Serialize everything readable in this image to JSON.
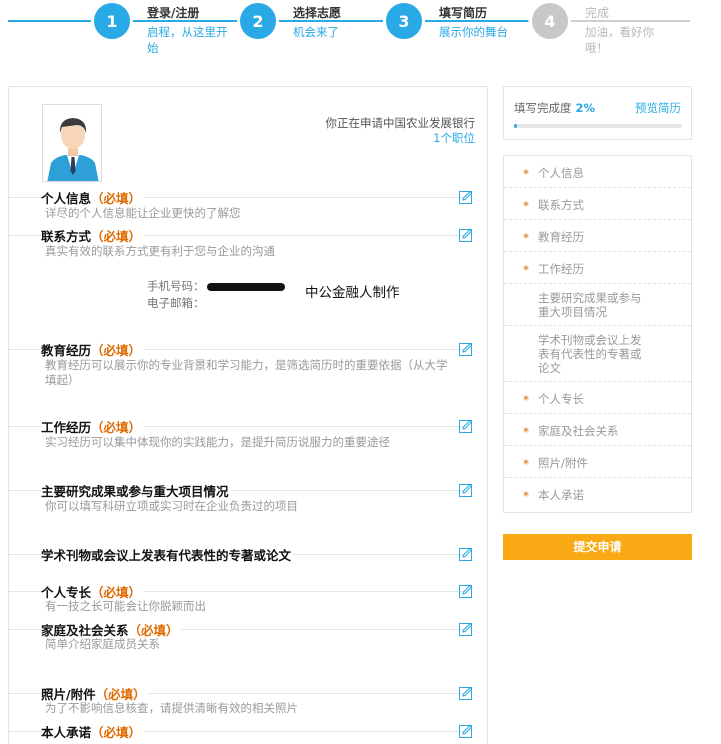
{
  "steps": [
    {
      "num": "1",
      "title": "登录/注册",
      "sub": "启程，从这里开始"
    },
    {
      "num": "2",
      "title": "选择志愿",
      "sub": "机会来了"
    },
    {
      "num": "3",
      "title": "填写简历",
      "sub": "展示你的舞台"
    },
    {
      "num": "4",
      "title": "完成",
      "sub": "加油，看好你哦！"
    }
  ],
  "apply": {
    "org_text": "你正在申请中国农业发展银行",
    "count_text": "1个职位"
  },
  "required_mark": "（必填）",
  "sections": {
    "personal": {
      "title": "个人信息",
      "desc": "详尽的个人信息能让企业更快的了解您"
    },
    "contact": {
      "title": "联系方式",
      "desc": "真实有效的联系方式更有利于您与企业的沟通"
    },
    "education": {
      "title": "教育经历",
      "desc": "教育经历可以展示你的专业背景和学习能力，是筛选简历时的重要依据（从大学填起）"
    },
    "work": {
      "title": "工作经历",
      "desc": "实习经历可以集中体现你的实践能力，是提升简历说服力的重要途径"
    },
    "research": {
      "title": "主要研究成果或参与重大项目情况",
      "desc": "你可以填写科研立项或实习时在企业负责过的项目"
    },
    "papers": {
      "title": "学术刊物或会议上发表有代表性的专著或论文"
    },
    "skills": {
      "title": "个人专长",
      "desc": "有一技之长可能会让你脱颖而出"
    },
    "family": {
      "title": "家庭及社会关系",
      "desc": "简单介绍家庭成员关系"
    },
    "photos": {
      "title": "照片/附件",
      "desc": "为了不影响信息核查，请提供清晰有效的相关照片"
    },
    "pledge": {
      "title": "本人承诺"
    }
  },
  "contact_info": {
    "phone_label": "手机号码：",
    "email_label": "电子邮箱："
  },
  "watermark": "中公金融人制作",
  "progress": {
    "label": "填写完成度",
    "value_text": "2%",
    "fraction": 0.02,
    "preview": "预览简历"
  },
  "nav": [
    {
      "label": "个人信息",
      "required": true
    },
    {
      "label": "联系方式",
      "required": true
    },
    {
      "label": "教育经历",
      "required": true
    },
    {
      "label": "工作经历",
      "required": true
    },
    {
      "label": "主要研究成果或参与重大项目情况",
      "required": false
    },
    {
      "label": "学术刊物或会议上发表有代表性的专著或论文",
      "required": false
    },
    {
      "label": "个人专长",
      "required": true
    },
    {
      "label": "家庭及社会关系",
      "required": true
    },
    {
      "label": "照片/附件",
      "required": true
    },
    {
      "label": "本人承诺",
      "required": true
    }
  ],
  "submit_label": "提交申请",
  "colors": {
    "accent": "#29a9e6",
    "required": "#e06a00",
    "submit": "#f8a913",
    "inactive": "#c8c8c8"
  }
}
